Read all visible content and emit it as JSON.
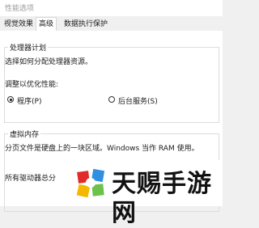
{
  "window": {
    "title": "性能选项"
  },
  "tabs": [
    {
      "label": "视觉效果",
      "active": false
    },
    {
      "label": "高级",
      "active": true
    },
    {
      "label": "数据执行保护",
      "active": false
    }
  ],
  "processor_scheduling": {
    "legend": "处理器计划",
    "description": "选择如何分配处理器资源。",
    "adjust_label": "调整以优化性能:",
    "options": [
      {
        "label": "程序(P)",
        "checked": true
      },
      {
        "label": "后台服务(S)",
        "checked": false
      }
    ]
  },
  "virtual_memory": {
    "legend": "虚拟内存",
    "description": "分页文件是硬盘上的一块区域。Windows 当作 RAM 使用。",
    "all_drives_label": "所有驱动器总分"
  },
  "watermark": {
    "text": "天赐手游网",
    "colors": {
      "red": "#e12b2b",
      "blue": "#2f8fe0",
      "green": "#6cc24a",
      "yellow": "#f5b800"
    }
  }
}
